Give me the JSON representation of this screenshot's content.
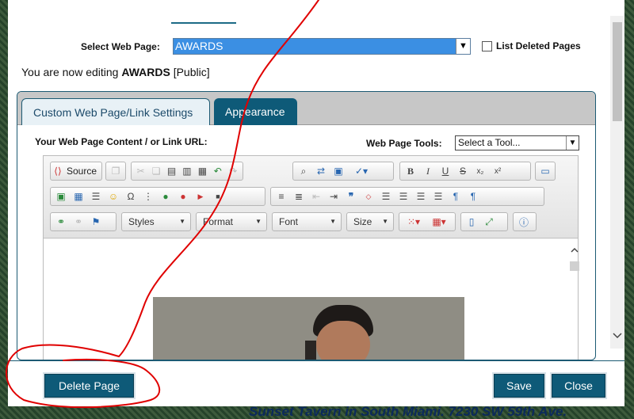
{
  "header": {
    "select_label": "Select Web Page:",
    "selected_page": "AWARDS",
    "list_deleted_label": "List Deleted Pages"
  },
  "editing": {
    "prefix": "You are now editing ",
    "page": "AWARDS",
    "status": " [Public]"
  },
  "tabs": [
    {
      "label": "Custom Web Page/Link Settings",
      "active": true
    },
    {
      "label": "Appearance",
      "active": false
    }
  ],
  "content": {
    "label": "Your Web Page Content / or Link URL:",
    "tools_label": "Web Page Tools:",
    "tools_value": "Select a Tool..."
  },
  "toolbar": {
    "source_label": "Source",
    "styles_label": "Styles",
    "format_label": "Format",
    "font_label": "Font",
    "size_label": "Size"
  },
  "footer": {
    "delete_label": "Delete Page",
    "save_label": "Save",
    "close_label": "Close"
  },
  "background": {
    "text": "Sunset Tavern in South Miami. 7230 SW 59th Ave."
  },
  "colors": {
    "accent": "#0e5a78",
    "annotation": "#e00000",
    "selection": "#3b8fe3"
  }
}
